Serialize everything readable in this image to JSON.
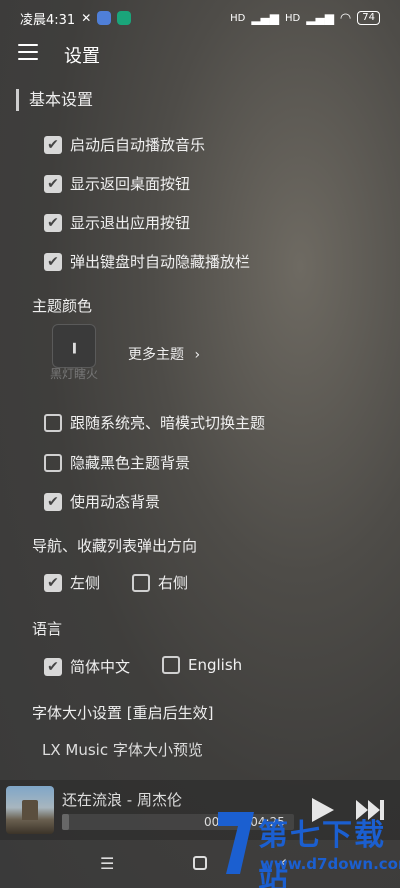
{
  "status_bar": {
    "time": "凌晨4:31",
    "signal_labels": [
      "HD",
      "HD"
    ],
    "battery": "74",
    "icons": [
      "mute-icon",
      "app-icon-blue",
      "app-icon-green",
      "signal-icon",
      "signal-icon",
      "wifi-icon"
    ]
  },
  "header": {
    "title": "设置",
    "menu_icon": "hamburger-menu-icon"
  },
  "basic": {
    "title": "基本设置",
    "options": [
      {
        "label": "启动后自动播放音乐",
        "checked": true
      },
      {
        "label": "显示返回桌面按钮",
        "checked": true
      },
      {
        "label": "显示退出应用按钮",
        "checked": true
      },
      {
        "label": "弹出键盘时自动隐藏播放栏",
        "checked": true
      }
    ]
  },
  "theme": {
    "title": "主题颜色",
    "tile_label": "黑灯瞎火",
    "more": "更多主题",
    "options": [
      {
        "label": "跟随系统亮、暗模式切换主题",
        "checked": false
      },
      {
        "label": "隐藏黑色主题背景",
        "checked": false
      },
      {
        "label": "使用动态背景",
        "checked": true
      }
    ]
  },
  "nav_direction": {
    "title": "导航、收藏列表弹出方向",
    "options": [
      {
        "label": "左侧",
        "checked": true
      },
      {
        "label": "右侧",
        "checked": false
      }
    ]
  },
  "language": {
    "title": "语言",
    "options": [
      {
        "label": "简体中文",
        "checked": true
      },
      {
        "label": "English",
        "checked": false
      }
    ]
  },
  "font": {
    "title": "字体大小设置 [重启后生效]",
    "preview": "LX Music 字体大小预览"
  },
  "player": {
    "song": "还在流浪 - 周杰伦",
    "time": "00:08 / 04:25",
    "progress": 0.03
  },
  "watermark": {
    "title": "第七下载站",
    "url": "www.d7down.com"
  },
  "colors": {
    "accent": "#d8d8d8",
    "watermark": "#1b5fd0"
  }
}
